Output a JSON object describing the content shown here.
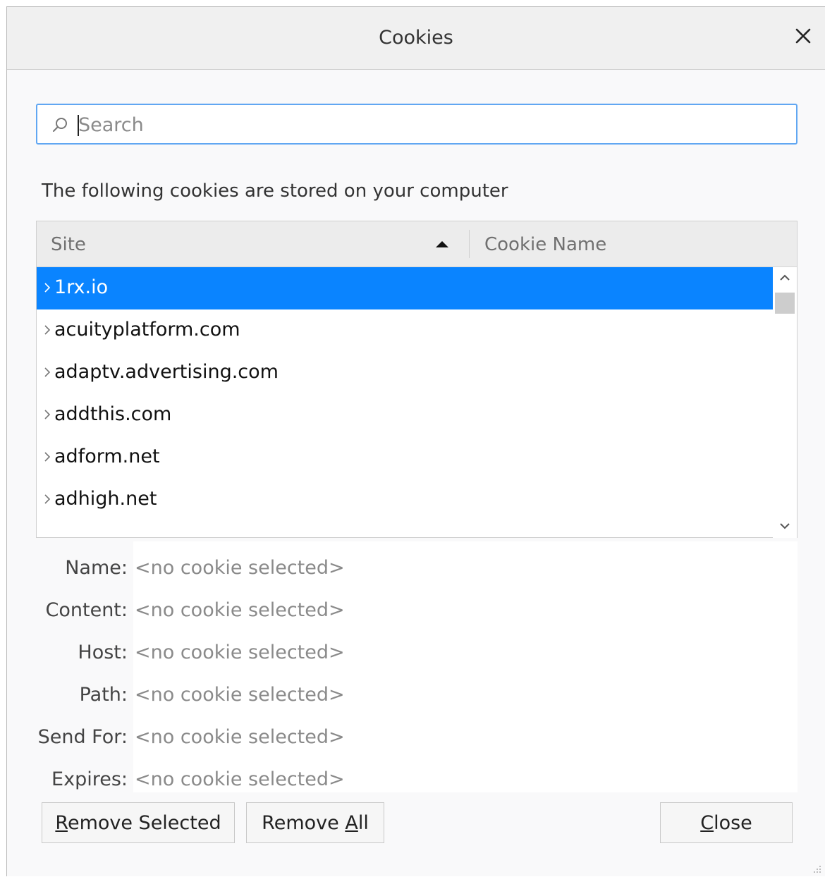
{
  "dialog": {
    "title": "Cookies"
  },
  "search": {
    "placeholder": "Search",
    "value": ""
  },
  "description": "The following cookies are stored on your computer",
  "tree": {
    "columns": [
      "Site",
      "Cookie Name"
    ],
    "sort_column": "Site",
    "sort_direction": "ascending",
    "rows": [
      {
        "label": "1rx.io",
        "selected": true
      },
      {
        "label": "acuityplatform.com",
        "selected": false
      },
      {
        "label": "adaptv.advertising.com",
        "selected": false
      },
      {
        "label": "addthis.com",
        "selected": false
      },
      {
        "label": "adform.net",
        "selected": false
      },
      {
        "label": "adhigh.net",
        "selected": false
      }
    ]
  },
  "details": [
    {
      "label": "Name:",
      "value": "<no cookie selected>"
    },
    {
      "label": "Content:",
      "value": "<no cookie selected>"
    },
    {
      "label": "Host:",
      "value": "<no cookie selected>"
    },
    {
      "label": "Path:",
      "value": "<no cookie selected>"
    },
    {
      "label": "Send For:",
      "value": "<no cookie selected>"
    },
    {
      "label": "Expires:",
      "value": "<no cookie selected>"
    }
  ],
  "buttons": {
    "remove_selected": {
      "accesskey_char": "R",
      "rest": "emove Selected"
    },
    "remove_all": {
      "before": "Remove ",
      "accesskey_char": "A",
      "after": "ll"
    },
    "close": {
      "accesskey_char": "C",
      "rest": "lose"
    }
  },
  "colors": {
    "selection": "#0a84ff",
    "search_focus_border": "#61a7f2"
  },
  "icons": [
    "close-icon",
    "search-icon",
    "chevron-right-icon",
    "sort-ascending-icon",
    "scroll-up-icon",
    "scroll-down-icon",
    "resize-grip-icon"
  ]
}
